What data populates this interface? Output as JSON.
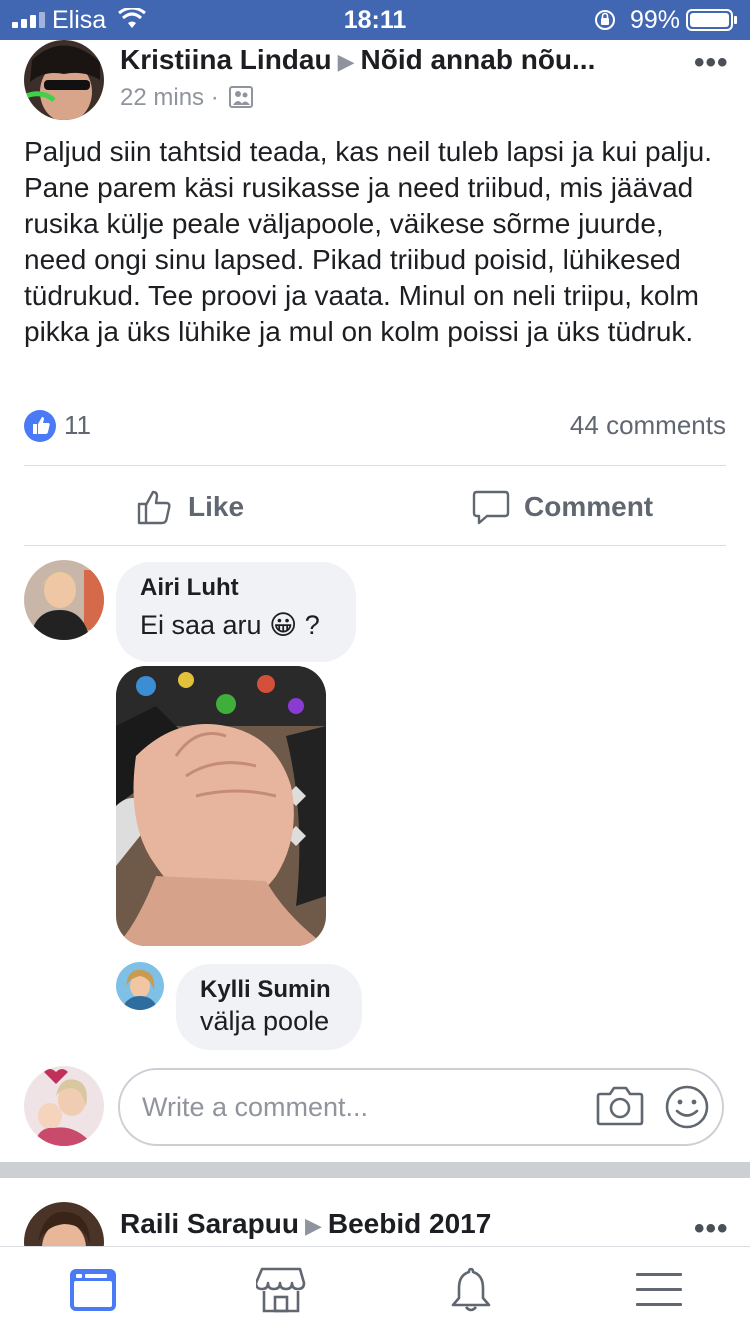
{
  "status_bar": {
    "carrier": "Elisa",
    "time": "18:11",
    "battery": "99%"
  },
  "post": {
    "author": "Kristiina Lindau",
    "group": "Nõid annab nõu...",
    "time": "22 mins",
    "separator": "·",
    "body": "Paljud siin tahtsid teada, kas neil tuleb lapsi ja kui palju. Pane parem käsi rusikasse ja need triibud, mis jäävad rusika külje peale väljapoole, väikese sõrme juurde, need ongi sinu lapsed. Pikad triibud poisid, lühikesed tüdrukud. Tee proovi ja vaata. Minul on neli triipu, kolm pikka ja üks lühike ja mul on kolm poissi ja üks tüdruk.",
    "like_count": "11",
    "comment_count": "44 comments",
    "actions": {
      "like": "Like",
      "comment": "Comment"
    },
    "more_icon": "more-dots-icon"
  },
  "comments": [
    {
      "name": "Airi Luht",
      "text": "Ei saa aru",
      "emoji": "😀",
      "suffix": "?"
    },
    {
      "name": "Kylli Sumin",
      "text": "välja poole"
    }
  ],
  "composer": {
    "placeholder": "Write a comment...",
    "icons": [
      "camera-icon",
      "smiley-icon"
    ]
  },
  "next_post": {
    "author": "Raili Sarapuu",
    "group": "Beebid 2017"
  },
  "tab_bar": {
    "tabs": [
      "news-feed-icon",
      "marketplace-icon",
      "notifications-icon",
      "menu-icon"
    ],
    "active_color": "#4a7af5",
    "inactive_color": "#606770"
  },
  "colors": {
    "brand": "#4267b2",
    "like_blue": "#4a7af5"
  }
}
